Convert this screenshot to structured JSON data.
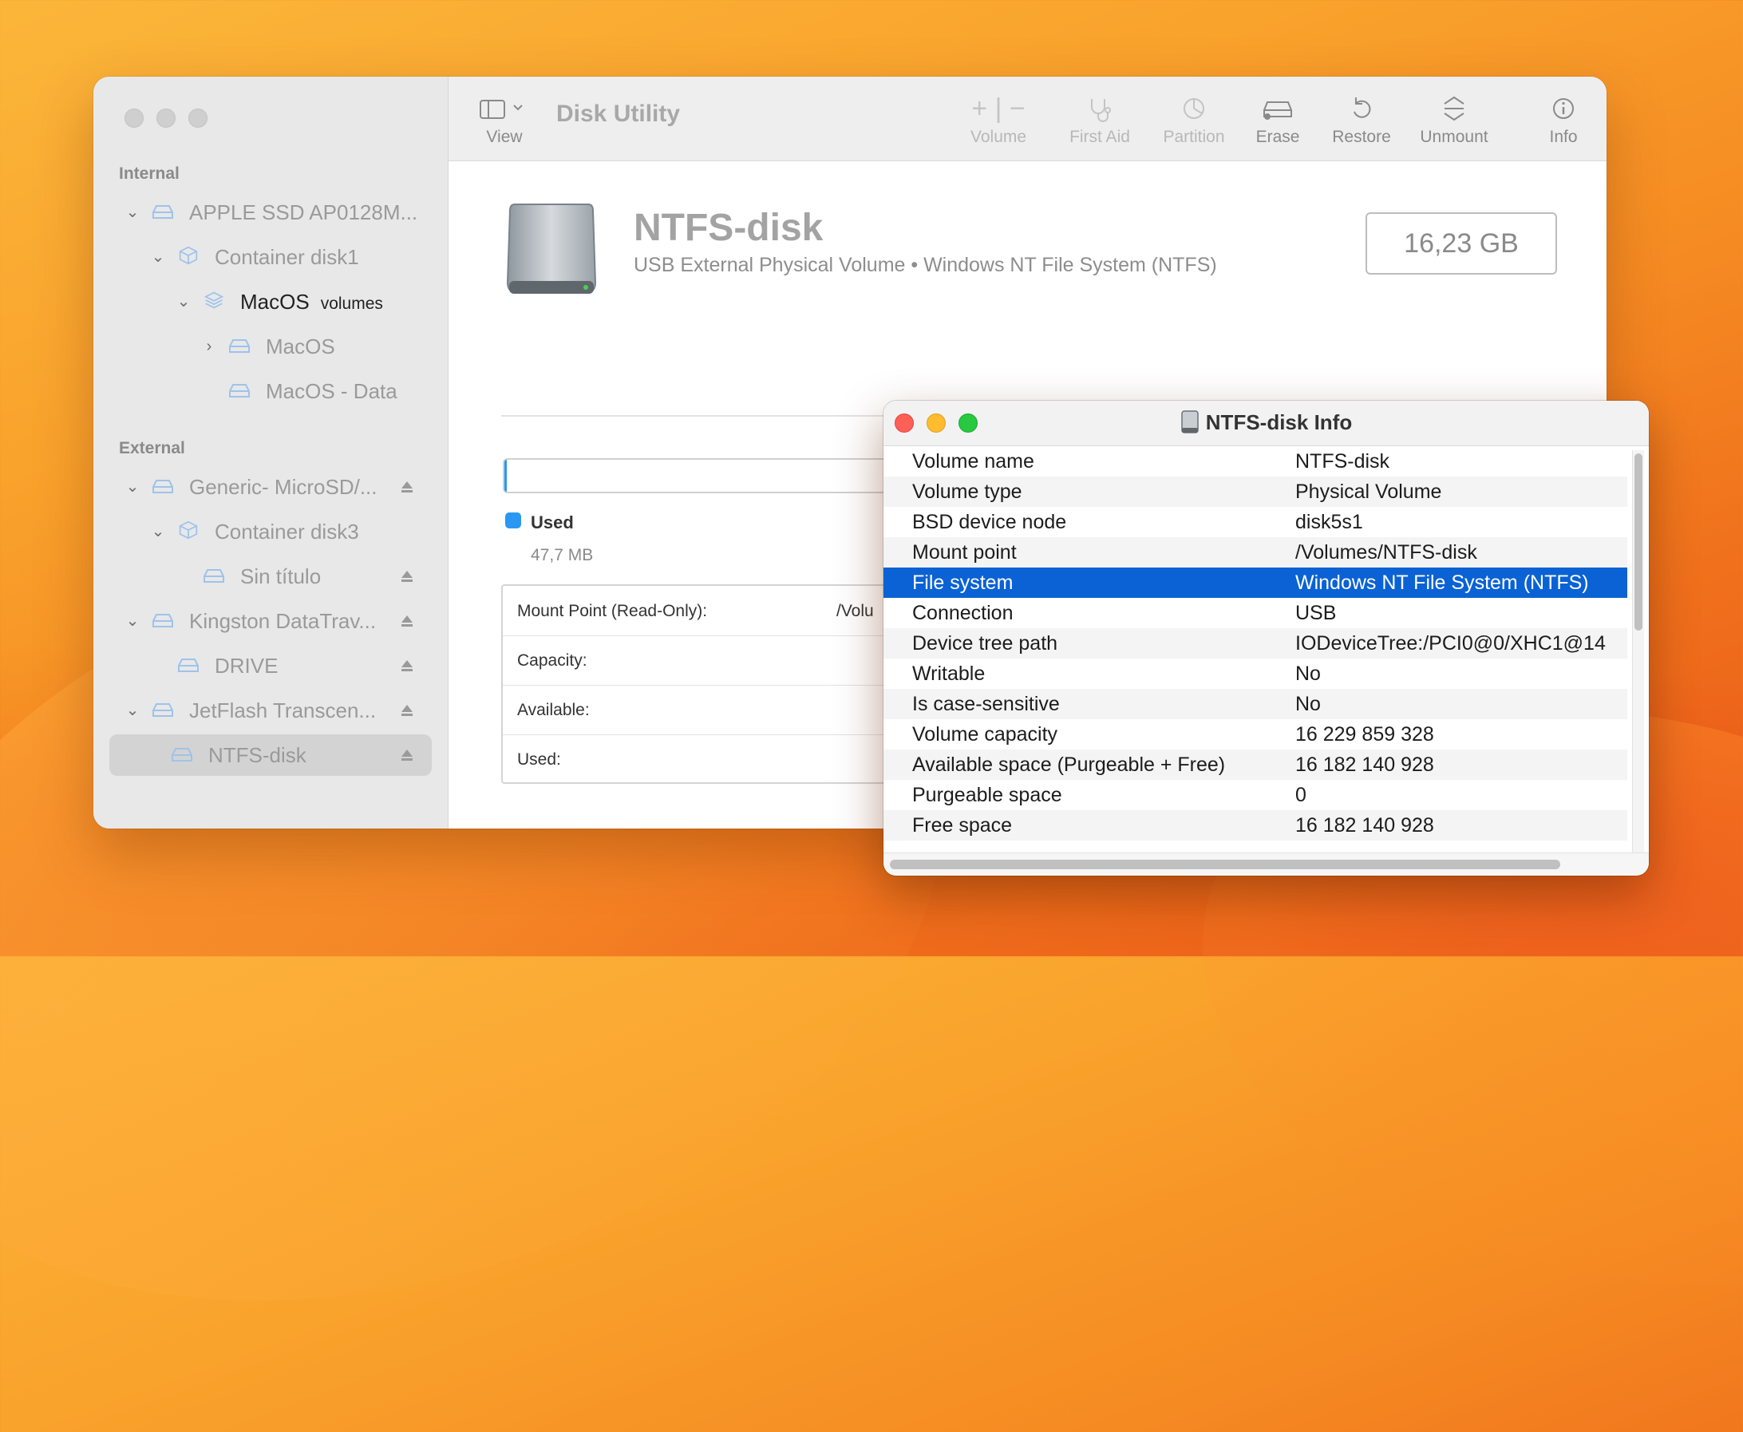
{
  "app": {
    "title": "Disk Utility"
  },
  "sidebar": {
    "sections": {
      "internal": "Internal",
      "external": "External"
    },
    "items": [
      {
        "label": "APPLE SSD AP0128M..."
      },
      {
        "label": "Container disk1"
      },
      {
        "label": "MacOS",
        "sub": "volumes"
      },
      {
        "label": "MacOS"
      },
      {
        "label": "MacOS - Data"
      },
      {
        "label": "Generic- MicroSD/..."
      },
      {
        "label": "Container disk3"
      },
      {
        "label": "Sin título"
      },
      {
        "label": "Kingston DataTrav..."
      },
      {
        "label": "DRIVE"
      },
      {
        "label": "JetFlash Transcen..."
      },
      {
        "label": "NTFS-disk"
      }
    ]
  },
  "toolbar": {
    "view": "View",
    "volume": "Volume",
    "first_aid": "First Aid",
    "partition": "Partition",
    "erase": "Erase",
    "restore": "Restore",
    "unmount": "Unmount",
    "info": "Info"
  },
  "disk": {
    "name": "NTFS-disk",
    "subtitle": "USB External Physical Volume • Windows NT File System (NTFS)",
    "capacity": "16,23 GB"
  },
  "usage": {
    "legend_label": "Used",
    "legend_value": "47,7 MB",
    "accent_color": "#2a97f2"
  },
  "details": [
    {
      "label": "Mount Point (Read-Only):",
      "value": "/Volu"
    },
    {
      "label": "Capacity:",
      "value": ""
    },
    {
      "label": "Available:",
      "value": ""
    },
    {
      "label": "Used:",
      "value": ""
    }
  ],
  "info_window": {
    "title": "NTFS-disk Info",
    "rows": [
      {
        "key": "Volume name",
        "value": "NTFS-disk"
      },
      {
        "key": "Volume type",
        "value": "Physical Volume"
      },
      {
        "key": "BSD device node",
        "value": "disk5s1"
      },
      {
        "key": "Mount point",
        "value": "/Volumes/NTFS-disk"
      },
      {
        "key": "File system",
        "value": "Windows NT File System (NTFS)"
      },
      {
        "key": "Connection",
        "value": "USB"
      },
      {
        "key": "Device tree path",
        "value": "IODeviceTree:/PCI0@0/XHC1@14"
      },
      {
        "key": "Writable",
        "value": "No"
      },
      {
        "key": "Is case-sensitive",
        "value": "No"
      },
      {
        "key": "Volume capacity",
        "value": "16 229 859 328"
      },
      {
        "key": "Available space (Purgeable + Free)",
        "value": "16 182 140 928"
      },
      {
        "key": "Purgeable space",
        "value": "0"
      },
      {
        "key": "Free space",
        "value": "16 182 140 928"
      }
    ],
    "selected_color": "#0a62d4"
  }
}
